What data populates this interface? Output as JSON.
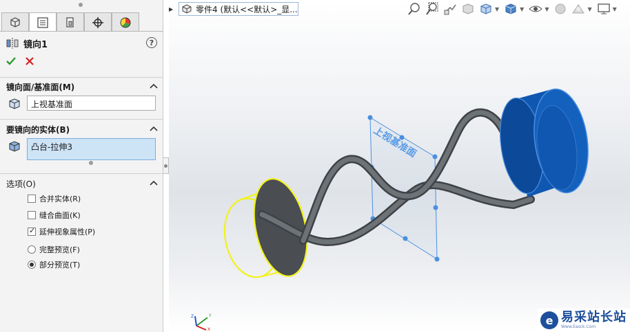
{
  "panel": {
    "feature_title": "镜向1",
    "help_label": "?",
    "tabs": [
      {
        "icon": "feature-manager-icon"
      },
      {
        "icon": "property-manager-icon"
      },
      {
        "icon": "configuration-manager-icon"
      },
      {
        "icon": "dimxpert-manager-icon"
      },
      {
        "icon": "display-manager-icon"
      }
    ],
    "mirror_plane": {
      "title": "镜向面/基准面(M)",
      "value": "上视基准面"
    },
    "bodies": {
      "title": "要镜向的实体(B)",
      "value": "凸台-拉伸3"
    },
    "options": {
      "title": "选项(O)",
      "checkboxes": [
        {
          "label": "合并实体(R)",
          "checked": false
        },
        {
          "label": "缝合曲面(K)",
          "checked": false
        },
        {
          "label": "延伸视象属性(P)",
          "checked": true
        }
      ],
      "radios": [
        {
          "label": "完整预览(F)",
          "checked": false
        },
        {
          "label": "部分预览(T)",
          "checked": true
        }
      ]
    }
  },
  "viewport": {
    "breadcrumb": "零件4  (默认<<默认>_显...",
    "plane_label": "上视基准面",
    "triad": {
      "x": "X",
      "y": "Y",
      "z": "Z"
    }
  },
  "watermark": {
    "title": "易采站长站",
    "url": "Www.Easck.Com"
  },
  "colors": {
    "accent_blue": "#1e6fd9",
    "preview_yellow": "#f2f21a",
    "body_blue": "#0f57b0",
    "tube_gray": "#55595e"
  }
}
